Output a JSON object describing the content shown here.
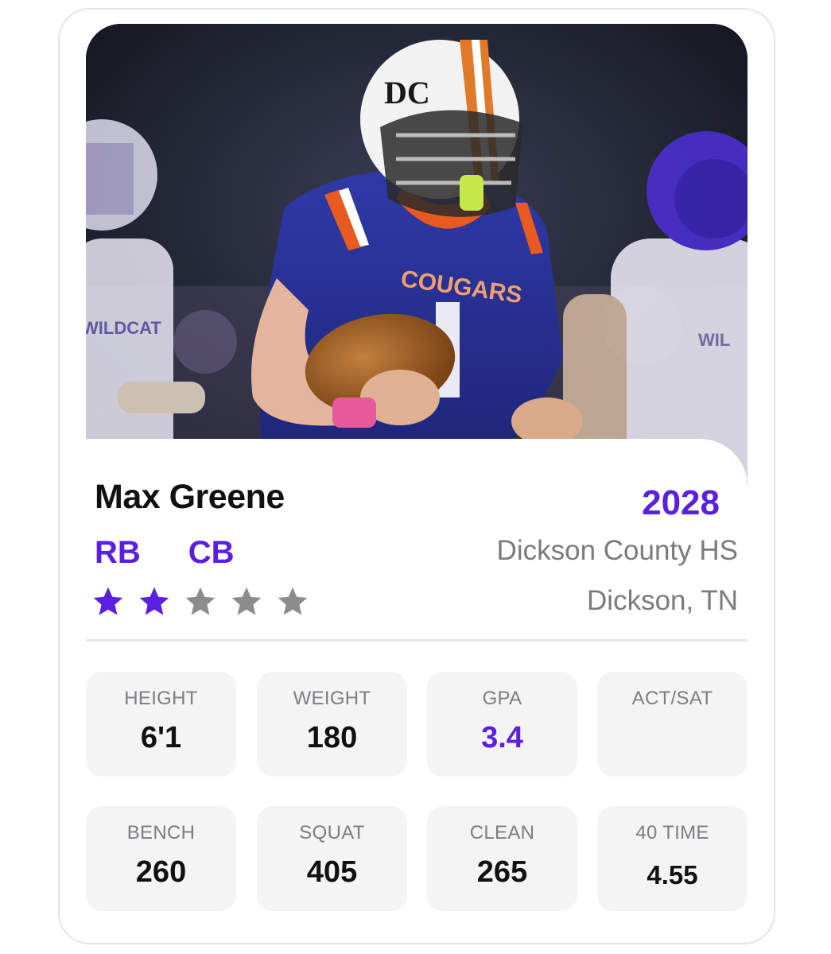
{
  "player": {
    "name": "Max Greene",
    "class_year": "2028",
    "positions": [
      "RB",
      "CB"
    ],
    "school": "Dickson County HS",
    "location": "Dickson, TN",
    "star_rating": 2,
    "star_max": 5
  },
  "photo": {
    "jersey_text": "COUGARS",
    "helmet_logo": "DC",
    "opponent_text": "WILDCAT",
    "opponent_text_right": "WIL"
  },
  "stats_row1": [
    {
      "label": "HEIGHT",
      "value": "6'1"
    },
    {
      "label": "WEIGHT",
      "value": "180"
    },
    {
      "label": "GPA",
      "value": "3.4"
    },
    {
      "label": "ACT/SAT",
      "value": ""
    }
  ],
  "stats_row2": [
    {
      "label": "BENCH",
      "value": "260"
    },
    {
      "label": "SQUAT",
      "value": "405"
    },
    {
      "label": "CLEAN",
      "value": "265"
    },
    {
      "label": "40 TIME",
      "value": "4.55"
    }
  ],
  "colors": {
    "accent": "#5a1fe0",
    "star_filled": "#5a1fe0",
    "star_empty": "#8c8c8c",
    "muted_text": "#7b7b7b",
    "stat_tile": "#f4f4f5"
  },
  "icons": {
    "star": "star-icon"
  }
}
